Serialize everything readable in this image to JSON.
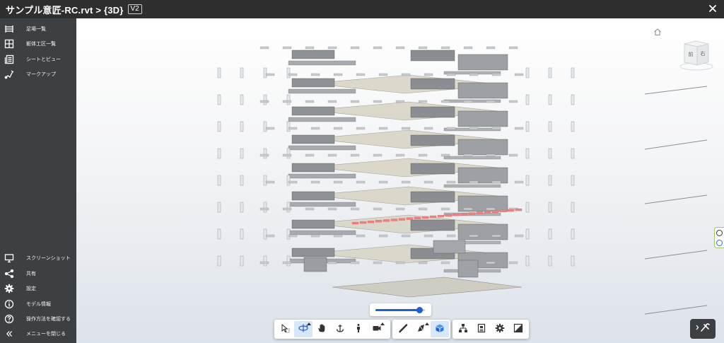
{
  "header": {
    "title": "サンプル意匠-RC.rvt > {3D}",
    "version_badge": "V2",
    "close_icon": "close-icon"
  },
  "sidebar": {
    "top_items": [
      {
        "label": "足場一覧",
        "icon": "scaffold-list-icon"
      },
      {
        "label": "躯体工区一覧",
        "icon": "grid-icon"
      },
      {
        "label": "シートとビュー",
        "icon": "sheets-icon"
      },
      {
        "label": "マークアップ",
        "icon": "markup-icon"
      }
    ],
    "bottom_items": [
      {
        "label": "スクリーンショット",
        "icon": "monitor-icon"
      },
      {
        "label": "共有",
        "icon": "share-icon"
      },
      {
        "label": "設定",
        "icon": "gear-icon"
      },
      {
        "label": "モデル情報",
        "icon": "info-icon"
      },
      {
        "label": "操作方法を確認する",
        "icon": "help-icon"
      },
      {
        "label": "メニューを閉じる",
        "icon": "double-chevron-left-icon"
      }
    ]
  },
  "viewcube": {
    "face_left": "前",
    "face_right": "右"
  },
  "slider": {
    "value_fraction": 0.88
  },
  "toolbar": {
    "groups": [
      [
        "select-icon",
        "orbit-icon",
        "pan-hand-icon",
        "anchor-icon",
        "walk-person-icon",
        "camera-icon"
      ],
      [
        "measure-icon",
        "section-icon",
        "cube-icon"
      ],
      [
        "model-tree-icon",
        "properties-icon",
        "gear-icon",
        "fullscreen-icon"
      ]
    ],
    "active": [
      "orbit-icon",
      "cube-icon"
    ]
  },
  "colors": {
    "topbar": "#2e2e2e",
    "sidebar": "#3d4043",
    "accent": "#1f5fd0",
    "model_highlight": "#f08080"
  }
}
